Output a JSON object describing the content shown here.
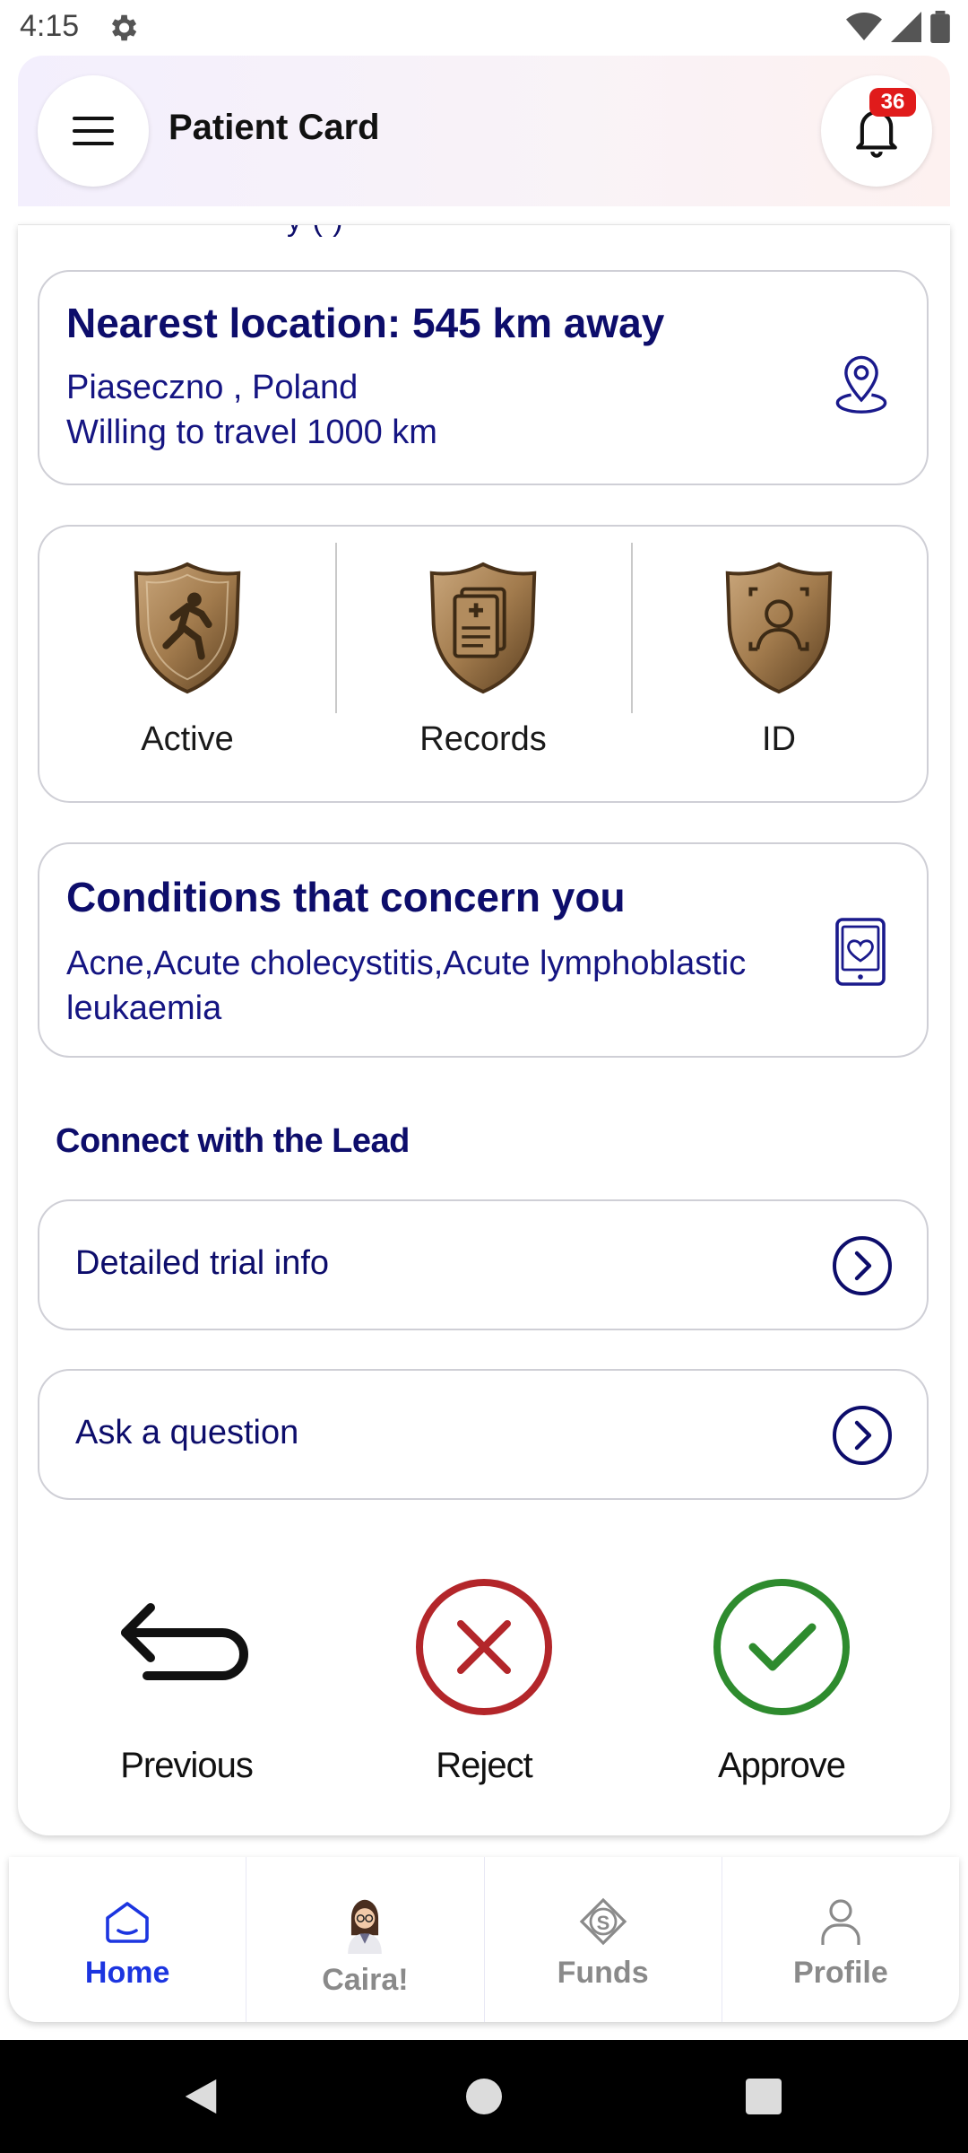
{
  "status_bar": {
    "time": "4:15"
  },
  "header": {
    "title": "Patient Card",
    "notification_count": "36"
  },
  "clipped_text": "y         (     )",
  "location": {
    "title": "Nearest location: 545 km away",
    "city_country": "Piaseczno , Poland",
    "travel": "Willing to travel  1000 km"
  },
  "badges": [
    {
      "label": "Active",
      "icon": "running-person-shield-icon"
    },
    {
      "label": "Records",
      "icon": "medical-records-shield-icon"
    },
    {
      "label": "ID",
      "icon": "person-id-shield-icon"
    }
  ],
  "conditions": {
    "title": "Conditions that concern you",
    "text": "Acne,Acute cholecystitis,Acute lymphoblastic leukaemia"
  },
  "connect": {
    "title": "Connect with the Lead",
    "links": [
      {
        "label": "Detailed trial info"
      },
      {
        "label": "Ask a question"
      }
    ]
  },
  "actions": {
    "previous": "Previous",
    "reject": "Reject",
    "approve": "Approve"
  },
  "colors": {
    "reject": "#b3262a",
    "approve": "#2e8b2e",
    "brand": "#0d0d6b",
    "active_nav": "#1c35e0"
  },
  "bottom_nav": [
    {
      "label": "Home",
      "icon": "home-icon",
      "active": true
    },
    {
      "label": "Caira!",
      "icon": "caira-avatar-icon",
      "active": false
    },
    {
      "label": "Funds",
      "icon": "funds-icon",
      "active": false
    },
    {
      "label": "Profile",
      "icon": "profile-icon",
      "active": false
    }
  ]
}
